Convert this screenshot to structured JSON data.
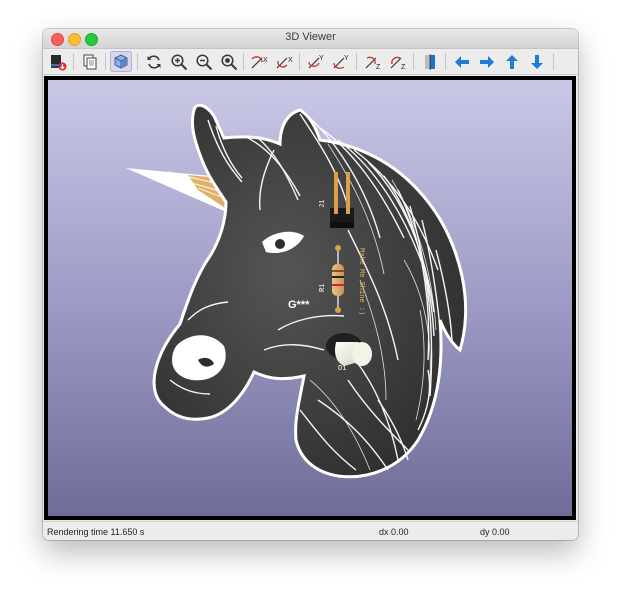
{
  "window": {
    "title": "3D Viewer"
  },
  "toolbar": {
    "buttons": [
      {
        "name": "export-button",
        "icon": "export-icon"
      },
      {
        "name": "copy-button",
        "icon": "copy-icon"
      },
      {
        "name": "render-mode-button",
        "icon": "cube-icon",
        "active": true
      },
      {
        "name": "reload-button",
        "icon": "refresh-icon"
      },
      {
        "name": "zoom-in-button",
        "icon": "zoom-in-icon"
      },
      {
        "name": "zoom-out-button",
        "icon": "zoom-out-icon"
      },
      {
        "name": "zoom-fit-button",
        "icon": "zoom-fit-icon"
      },
      {
        "name": "rotate-x-cw-button",
        "icon": "rotate-x-icon"
      },
      {
        "name": "rotate-x-ccw-button",
        "icon": "rotate-x-icon"
      },
      {
        "name": "rotate-y-cw-button",
        "icon": "rotate-y-icon"
      },
      {
        "name": "rotate-y-ccw-button",
        "icon": "rotate-y-icon"
      },
      {
        "name": "rotate-z-cw-button",
        "icon": "rotate-z-icon"
      },
      {
        "name": "rotate-z-ccw-button",
        "icon": "rotate-z-icon"
      },
      {
        "name": "flip-board-button",
        "icon": "flip-board-icon"
      },
      {
        "name": "move-left-button",
        "icon": "arrow-left-icon"
      },
      {
        "name": "move-right-button",
        "icon": "arrow-right-icon"
      },
      {
        "name": "move-up-button",
        "icon": "arrow-up-icon"
      },
      {
        "name": "move-down-button",
        "icon": "arrow-down-icon"
      }
    ],
    "axis_labels": {
      "x": "X",
      "y": "Y",
      "z": "Z"
    }
  },
  "board": {
    "silkscreen": {
      "ref_j1": "J1",
      "ref_r1": "R1",
      "ref_d1": "D1",
      "logo_ref": "G***",
      "text": "Make Me Shine :)"
    },
    "colors": {
      "pcb": "#3a3a3a",
      "silk": "#ffffff",
      "gold": "#d9a24a",
      "background_top": "#c9c8e6",
      "background_bottom": "#6e6d99"
    }
  },
  "status": {
    "rendering": "Rendering time 11.650 s",
    "dx": "dx 0.00",
    "dy": "dy 0.00"
  }
}
